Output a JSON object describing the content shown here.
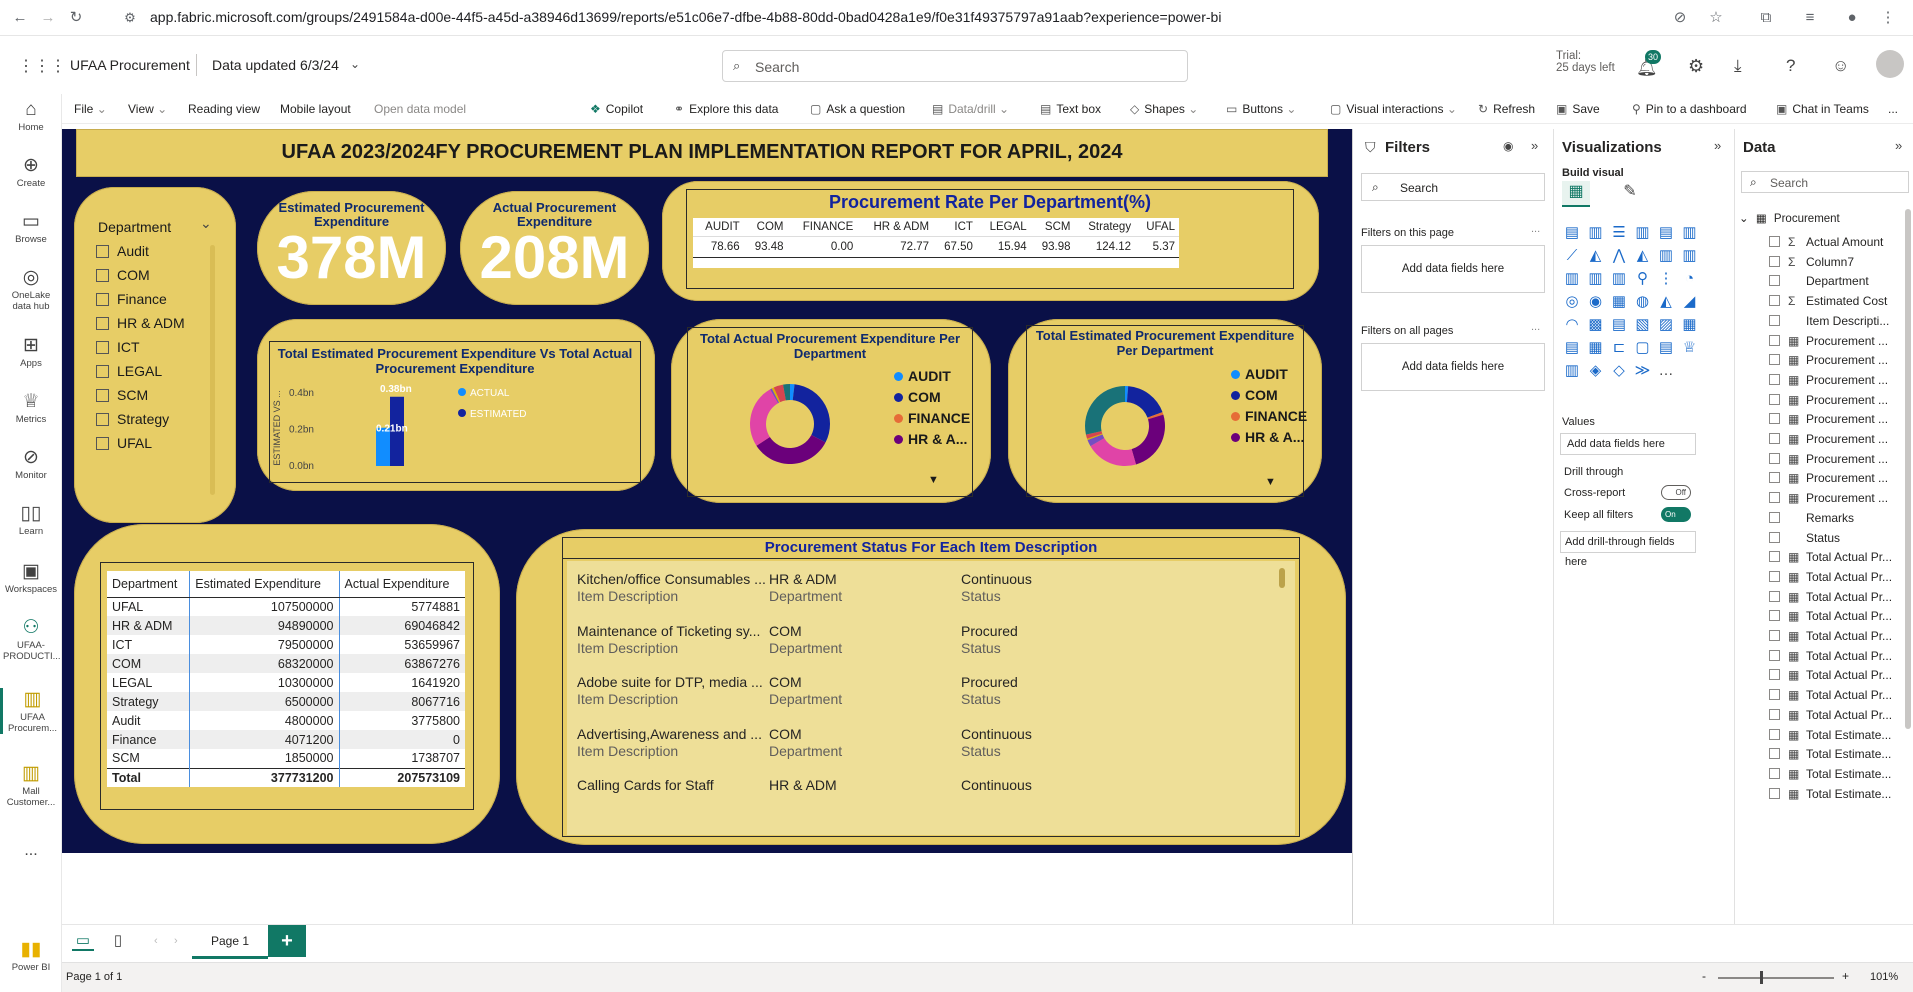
{
  "browser": {
    "url": "app.fabric.microsoft.com/groups/2491584a-d00e-44f5-a45d-a38946d13699/reports/e51c06e7-dfbe-4b88-80dd-0bad0428a1e9/f0e31f49375797a91aab?experience=power-bi"
  },
  "app": {
    "workspace": "UFAA Procurement",
    "data_updated": "Data updated 6/3/24",
    "search_placeholder": "Search",
    "trial_line1": "Trial:",
    "trial_line2": "25 days left",
    "notifications": "30"
  },
  "rail": {
    "items": [
      {
        "label": "Home",
        "icon": "home-icon"
      },
      {
        "label": "Create",
        "icon": "plus-icon"
      },
      {
        "label": "Browse",
        "icon": "folder-icon"
      },
      {
        "label": "OneLake data hub",
        "icon": "onelake-icon"
      },
      {
        "label": "Apps",
        "icon": "apps-icon"
      },
      {
        "label": "Metrics",
        "icon": "trophy-icon"
      },
      {
        "label": "Monitor",
        "icon": "monitor-icon"
      },
      {
        "label": "Learn",
        "icon": "book-icon"
      },
      {
        "label": "Workspaces",
        "icon": "workspaces-icon"
      },
      {
        "label": "UFAA-PRODUCTI...",
        "icon": "workspace-people-icon"
      },
      {
        "label": "UFAA Procurem...",
        "icon": "report-icon"
      },
      {
        "label": "Mall Customer...",
        "icon": "report-icon"
      }
    ],
    "more": "...",
    "brand": "Power BI"
  },
  "toolbar": {
    "file": "File",
    "view": "View",
    "reading_view": "Reading view",
    "mobile_layout": "Mobile layout",
    "open_data_model": "Open data model",
    "copilot": "Copilot",
    "explore": "Explore this data",
    "ask": "Ask a question",
    "data_drill": "Data/drill",
    "text_box": "Text box",
    "shapes": "Shapes",
    "buttons": "Buttons",
    "visual_interactions": "Visual interactions",
    "refresh": "Refresh",
    "save": "Save",
    "pin": "Pin to a dashboard",
    "chat": "Chat in Teams",
    "more": "..."
  },
  "report": {
    "title": "UFAA 2023/2024FY PROCUREMENT PLAN IMPLEMENTATION REPORT FOR APRIL, 2024",
    "slicer": {
      "header": "Department",
      "items": [
        "Audit",
        "COM",
        "Finance",
        "HR & ADM",
        "ICT",
        "LEGAL",
        "SCM",
        "Strategy",
        "UFAL"
      ]
    },
    "kpi_estimated": {
      "label": "Estimated Procurement Expenditure",
      "value": "378M"
    },
    "kpi_actual": {
      "label": "Actual Procurement Expenditure",
      "value": "208M"
    },
    "rate": {
      "title": "Procurement Rate Per Department(%)",
      "headers": [
        "AUDIT",
        "COM",
        "FINANCE",
        "HR & ADM",
        "ICT",
        "LEGAL",
        "SCM",
        "Strategy",
        "UFAL"
      ],
      "values": [
        "78.66",
        "93.48",
        "0.00",
        "72.77",
        "67.50",
        "15.94",
        "93.98",
        "124.12",
        "5.37"
      ]
    },
    "est_vs_act": {
      "title": "Total Estimated Procurement Expenditure Vs Total Actual Procurement Expenditure",
      "ylabel": "ESTIMATED VS ...",
      "ticks": [
        "0.4bn",
        "0.2bn",
        "0.0bn"
      ],
      "actual_label": "0.21bn",
      "estimated_label": "0.38bn",
      "legend_actual": "ACTUAL",
      "legend_estimated": "ESTIMATED",
      "color_actual": "#118dff",
      "color_estimated": "#12239e"
    },
    "donut_actual": {
      "title": "Total Actual Procurement Expenditure Per Department",
      "legend": [
        "AUDIT",
        "COM",
        "FINANCE",
        "HR & A..."
      ],
      "colors": [
        "#118dff",
        "#12239e",
        "#e66c37",
        "#6b007b"
      ]
    },
    "donut_estimated": {
      "title": "Total Estimated Procurement Expenditure Per Department",
      "legend": [
        "AUDIT",
        "COM",
        "FINANCE",
        "HR & A..."
      ],
      "colors": [
        "#118dff",
        "#12239e",
        "#e66c37",
        "#6b007b"
      ]
    },
    "dept_table": {
      "headers": [
        "Department",
        "Estimated Expenditure",
        "Actual Expenditure"
      ],
      "rows": [
        [
          "UFAL",
          "107500000",
          "5774881"
        ],
        [
          "HR & ADM",
          "94890000",
          "69046842"
        ],
        [
          "ICT",
          "79500000",
          "53659967"
        ],
        [
          "COM",
          "68320000",
          "63867276"
        ],
        [
          "LEGAL",
          "10300000",
          "1641920"
        ],
        [
          "Strategy",
          "6500000",
          "8067716"
        ],
        [
          "Audit",
          "4800000",
          "3775800"
        ],
        [
          "Finance",
          "4071200",
          "0"
        ],
        [
          "SCM",
          "1850000",
          "1738707"
        ]
      ],
      "total": [
        "Total",
        "377731200",
        "207573109"
      ]
    },
    "status_list": {
      "title": "Procurement Status For Each Item Description",
      "field_labels": [
        "Item Description",
        "Department",
        "Status"
      ],
      "items": [
        [
          "Kitchen/office Consumables ...",
          "HR & ADM",
          "Continuous"
        ],
        [
          "Maintenance of Ticketing sy...",
          "COM",
          "Procured"
        ],
        [
          "Adobe suite for DTP, media ...",
          "COM",
          "Procured"
        ],
        [
          "Advertising,Awareness and ...",
          "COM",
          "Continuous"
        ],
        [
          "Calling Cards for Staff",
          "HR & ADM",
          "Continuous"
        ]
      ]
    }
  },
  "filters": {
    "title": "Filters",
    "search_placeholder": "Search",
    "on_this_page": "Filters on this page",
    "on_all_pages": "Filters on all pages",
    "add_fields": "Add data fields here",
    "more": "..."
  },
  "visualizations": {
    "title": "Visualizations",
    "build_visual": "Build visual",
    "values": "Values",
    "add_fields": "Add data fields here",
    "drill_through": "Drill through",
    "cross_report": "Cross-report",
    "cross_report_state": "Off",
    "keep_filters": "Keep all filters",
    "keep_filters_state": "On",
    "add_drill": "Add drill-through fields here"
  },
  "data_pane": {
    "title": "Data",
    "search_placeholder": "Search",
    "table": "Procurement",
    "fields": [
      {
        "name": "Actual Amount",
        "kind": "sigma"
      },
      {
        "name": "Column7",
        "kind": "sigma"
      },
      {
        "name": "Department",
        "kind": "text"
      },
      {
        "name": "Estimated Cost",
        "kind": "sigma"
      },
      {
        "name": "Item Descripti...",
        "kind": "text"
      },
      {
        "name": "Procurement ...",
        "kind": "calc"
      },
      {
        "name": "Procurement ...",
        "kind": "calc"
      },
      {
        "name": "Procurement ...",
        "kind": "calc"
      },
      {
        "name": "Procurement ...",
        "kind": "calc"
      },
      {
        "name": "Procurement ...",
        "kind": "calc"
      },
      {
        "name": "Procurement ...",
        "kind": "calc"
      },
      {
        "name": "Procurement ...",
        "kind": "calc"
      },
      {
        "name": "Procurement ...",
        "kind": "calc"
      },
      {
        "name": "Procurement ...",
        "kind": "calc"
      },
      {
        "name": "Remarks",
        "kind": "text"
      },
      {
        "name": "Status",
        "kind": "text"
      },
      {
        "name": "Total Actual Pr...",
        "kind": "calc"
      },
      {
        "name": "Total Actual Pr...",
        "kind": "calc"
      },
      {
        "name": "Total Actual Pr...",
        "kind": "calc"
      },
      {
        "name": "Total Actual Pr...",
        "kind": "calc"
      },
      {
        "name": "Total Actual Pr...",
        "kind": "calc"
      },
      {
        "name": "Total Actual Pr...",
        "kind": "calc"
      },
      {
        "name": "Total Actual Pr...",
        "kind": "calc"
      },
      {
        "name": "Total Actual Pr...",
        "kind": "calc"
      },
      {
        "name": "Total Actual Pr...",
        "kind": "calc"
      },
      {
        "name": "Total Estimate...",
        "kind": "calc"
      },
      {
        "name": "Total Estimate...",
        "kind": "calc"
      },
      {
        "name": "Total Estimate...",
        "kind": "calc"
      },
      {
        "name": "Total Estimate...",
        "kind": "calc"
      }
    ]
  },
  "bottom": {
    "page_tab": "Page 1",
    "add_page": "+",
    "page_status": "Page 1 of 1",
    "zoom": "101%",
    "zoom_minus": "-",
    "zoom_plus": "+"
  }
}
